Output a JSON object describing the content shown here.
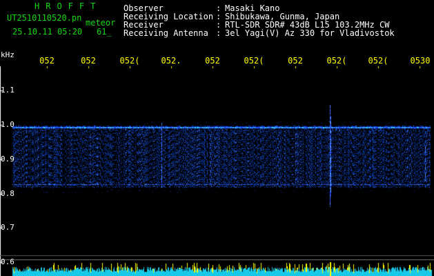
{
  "header": {
    "brand": "HROFFT",
    "filename": "UT2510110520.pn",
    "mode": "meteor",
    "datetime": "25.10.11 05:20",
    "count": "61_"
  },
  "info": [
    {
      "key": "Observer",
      "value": "Masaki Kano"
    },
    {
      "key": "Receiving Location",
      "value": "Shibukawa, Gunma, Japan"
    },
    {
      "key": "Receiver",
      "value": "RTL-SDR SDR# 43dB L15 103.2MHz CW"
    },
    {
      "key": "Receiving Antenna",
      "value": "3el Yagi(V) Az 330 for Vladivostok"
    }
  ],
  "info_colon": ":",
  "axis": {
    "y_unit": "kHz",
    "y_ticks": [
      "1.1",
      "1.0",
      "0.9",
      "0.8",
      "0.7",
      "0.6"
    ],
    "x_ticks": [
      "052",
      "052",
      "052(",
      "052.",
      "052",
      "052(",
      "052",
      "052(",
      "052(",
      "0530"
    ]
  },
  "colors": {
    "header_green": "#14d814",
    "text_white": "#ffffff",
    "tick_yellow": "#ffff00",
    "signal_blue": "#1a3cff",
    "signal_cyan": "#34e6ff",
    "baseline_yellow": "#ffff00"
  }
}
